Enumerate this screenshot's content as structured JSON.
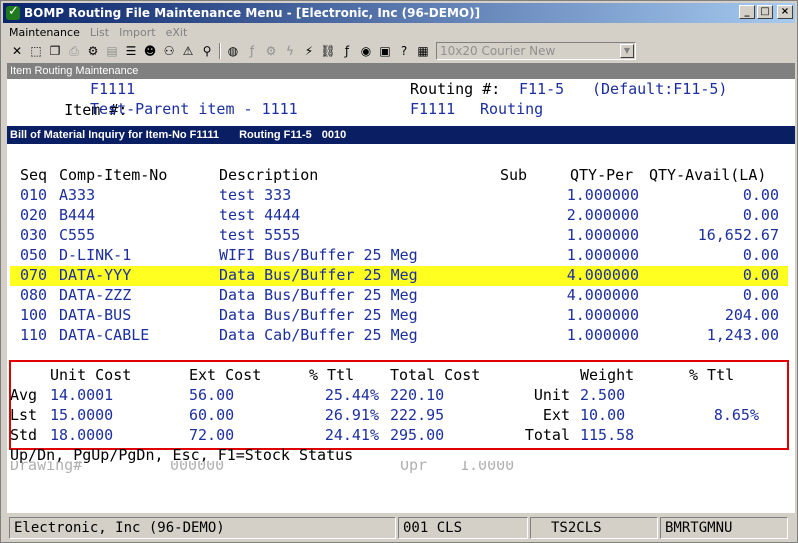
{
  "window": {
    "title": "BOMP Routing File Maintenance Menu - [Electronic, Inc (96-DEMO)]"
  },
  "menu": [
    "Maintenance",
    "List",
    "Import",
    "eXit"
  ],
  "toolbar": {
    "font_select": "10x20 Courier New"
  },
  "screen": {
    "header": "Item Routing Maintenance",
    "item_label": "Item #:",
    "item_value": "F1111",
    "item_desc": "Test-Parent item - 1111",
    "routing_label": "Routing #:",
    "routing_value": "F11-5",
    "routing_default": "(Default:F11-5)",
    "routing_desc_item": "F1111",
    "routing_desc_word": "Routing"
  },
  "bom_bar": {
    "title": "Bill of Material Inquiry for Item-No F1111",
    "routing": "Routing F11-5",
    "op": "0010"
  },
  "table": {
    "headers": [
      "Seq",
      "Comp-Item-No",
      "Description",
      "Sub",
      "QTY-Per",
      "QTY-Avail(LA)"
    ],
    "rows": [
      [
        "010",
        "A333",
        "test 333",
        "",
        "1.000000",
        "0.00"
      ],
      [
        "020",
        "B444",
        "test 4444",
        "",
        "2.000000",
        "0.00"
      ],
      [
        "030",
        "C555",
        "test 5555",
        "",
        "1.000000",
        "16,652.67"
      ],
      [
        "050",
        "D-LINK-1",
        "WIFI Bus/Buffer 25 Meg",
        "",
        "1.000000",
        "0.00"
      ],
      [
        "070",
        "DATA-YYY",
        "Data Bus/Buffer 25 Meg",
        "",
        "4.000000",
        "0.00"
      ],
      [
        "080",
        "DATA-ZZZ",
        "Data Bus/Buffer 25 Meg",
        "",
        "4.000000",
        "0.00"
      ],
      [
        "100",
        "DATA-BUS",
        "Data Bus/Buffer 25 Meg",
        "",
        "1.000000",
        "204.00"
      ],
      [
        "110",
        "DATA-CABLE",
        "Data Cab/Buffer 25 Meg",
        "",
        "1.000000",
        "1,243.00"
      ]
    ],
    "highlight_row": 4,
    "highlight_color": "#ffff20"
  },
  "costs": {
    "headers": {
      "unit_cost": "Unit Cost",
      "ext_cost": "Ext Cost",
      "pct_ttl": "% Ttl",
      "total_cost": "Total Cost",
      "weight": "Weight",
      "pct_ttl2": "% Ttl"
    },
    "rows": [
      {
        "label": "Avg",
        "unit": "14.0001",
        "ext": "56.00",
        "pct": "25.44%",
        "total": "220.10",
        "wlabel": "Unit",
        "wval": "2.500",
        "wpct": ""
      },
      {
        "label": "Lst",
        "unit": "15.0000",
        "ext": "60.00",
        "pct": "26.91%",
        "total": "222.95",
        "wlabel": "Ext",
        "wval": "10.00",
        "wpct": "8.65%"
      },
      {
        "label": "Std",
        "unit": "18.0000",
        "ext": "72.00",
        "pct": "24.41%",
        "total": "295.00",
        "wlabel": "Total",
        "wval": "115.58",
        "wpct": ""
      }
    ]
  },
  "help_line": "Up/Dn, PgUp/PgDn, Esc, F1=Stock Status",
  "behind_line": {
    "drawing_label": "Drawing#",
    "drawing_value": "000000",
    "opr_label": "Opr",
    "opr_value": "1.0000"
  },
  "status": {
    "company": "Electronic, Inc (96-DEMO)",
    "user": "001 CLS",
    "terminal": "TS2CLS",
    "program": "BMRTGMNU"
  },
  "colors": {
    "field_value": "#1c2fa0",
    "box_border": "#e00000",
    "bom_bar": "#0a1e63"
  }
}
